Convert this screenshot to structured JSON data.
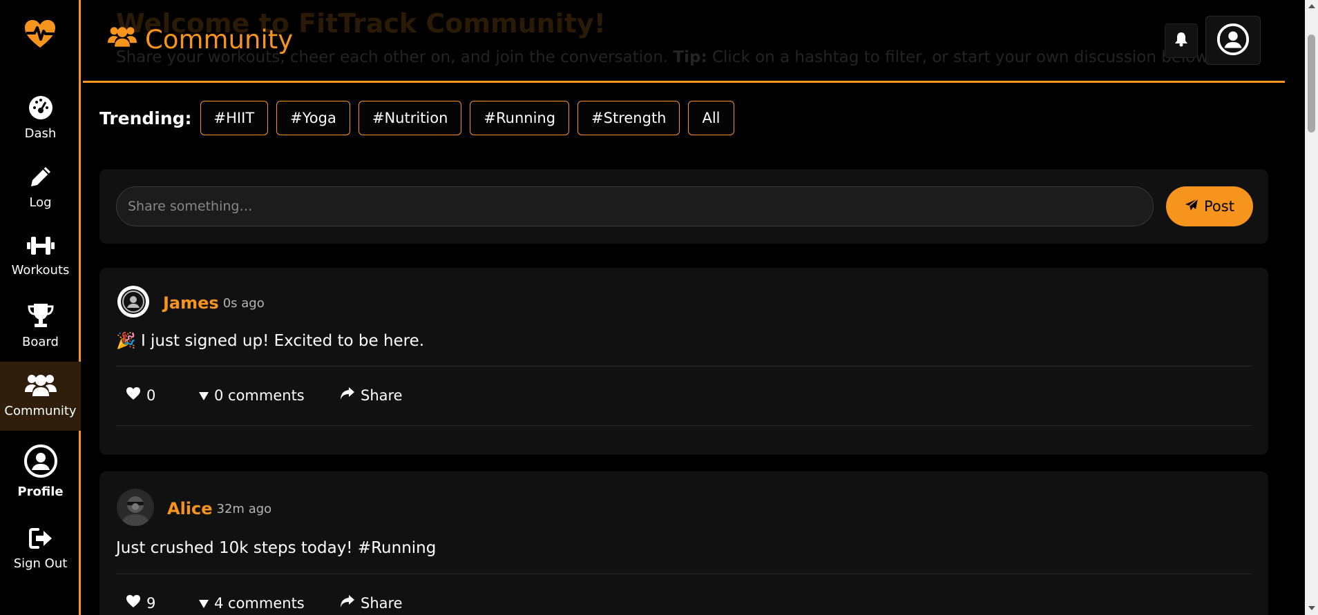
{
  "sidebar": {
    "items": [
      {
        "label": "Dash",
        "icon": "dashboard-icon"
      },
      {
        "label": "Log",
        "icon": "pencil-icon"
      },
      {
        "label": "Workouts",
        "icon": "dumbbell-icon"
      },
      {
        "label": "Board",
        "icon": "trophy-icon"
      },
      {
        "label": "Community",
        "icon": "users-icon",
        "active": true
      },
      {
        "label": "Profile",
        "icon": "user-circle-icon"
      },
      {
        "label": "Sign Out",
        "icon": "sign-out-icon"
      }
    ]
  },
  "header": {
    "title": "Community",
    "ghost_title": "Welcome to FitTrack Community!",
    "ghost_sub_pre": "Share your workouts, cheer each other on, and join the conversation.",
    "ghost_sub_tip": "Tip:",
    "ghost_sub_post": "Click on a hashtag to filter, or start your own discussion below."
  },
  "trending": {
    "label": "Trending:",
    "tags": [
      "#HIIT",
      "#Yoga",
      "#Nutrition",
      "#Running",
      "#Strength",
      "All"
    ]
  },
  "composer": {
    "placeholder": "Share something…",
    "post_label": "Post"
  },
  "posts": [
    {
      "author": "James",
      "time": "0s ago",
      "text": "🎉 I just signed up! Excited to be here.",
      "likes": "0",
      "comments": "0 comments",
      "share": "Share"
    },
    {
      "author": "Alice",
      "time": "32m ago",
      "text": "Just crushed 10k steps today! #Running",
      "likes": "9",
      "comments": "4 comments",
      "share": "Share"
    }
  ],
  "colors": {
    "accent": "#f7941d",
    "background": "#000000",
    "card": "#111111"
  }
}
